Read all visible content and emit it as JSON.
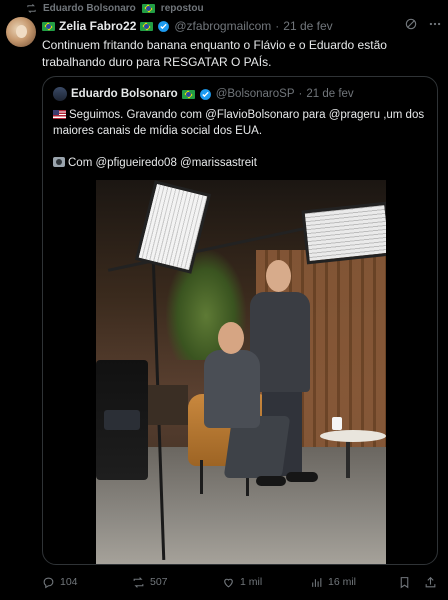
{
  "repost": {
    "user": "Eduardo Bolsonaro",
    "label": "repostou"
  },
  "tweet": {
    "name": "Zelia Fabro22",
    "handle": "@zfabrogmailcom",
    "time": "21 de fev",
    "text": "Continuem fritando banana enquanto o Flávio e o Eduardo estão trabalhando duro para RESGATAR O PAÍs."
  },
  "quote": {
    "name": "Eduardo Bolsonaro",
    "handle": "@BolsonaroSP",
    "time": "21 de fev",
    "text_line1": "Seguimos. Gravando com @FlavioBolsonaro para @prageru ,um dos maiores canais de mídia social dos EUA.",
    "text_line2": "Com @pfigueiredo08 @marissastreit"
  },
  "actions": {
    "replies": "104",
    "reposts": "507",
    "likes": "1 mil",
    "views": "16 mil"
  },
  "colors": {
    "background": "#000000",
    "text": "#e7e9ea",
    "muted": "#71767b",
    "border": "#2f3336",
    "verified": "#1d9bf0"
  }
}
